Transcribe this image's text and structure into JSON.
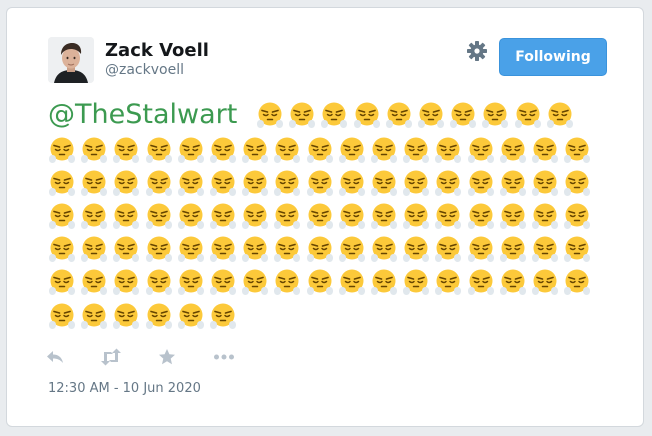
{
  "tweet": {
    "author": {
      "name": "Zack Voell",
      "handle": "@zackvoell"
    },
    "follow_button_label": "Following",
    "mention": "@TheStalwart",
    "emoji_name": "face-with-steam-from-nose",
    "emoji_count": 101,
    "timestamp": "12:30 AM - 10 Jun 2020"
  },
  "icons": {
    "settings": "gear-icon",
    "reply": "reply-icon",
    "retweet": "retweet-icon",
    "like": "star-icon",
    "more": "more-icon"
  },
  "colors": {
    "mention": "#3c9a50",
    "follow_button": "#4aa1e8",
    "action_icons": "#b8c2cc",
    "muted_text": "#657786"
  }
}
